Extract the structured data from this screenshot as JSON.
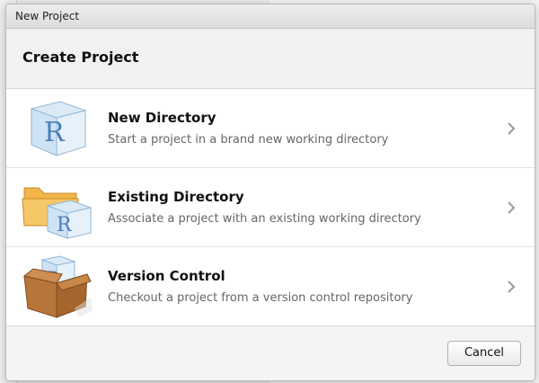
{
  "window": {
    "title": "New Project"
  },
  "header": {
    "title": "Create Project"
  },
  "options": [
    {
      "title": "New Directory",
      "description": "Start a project in a brand new working directory",
      "icon": "r-cube-icon"
    },
    {
      "title": "Existing Directory",
      "description": "Associate a project with an existing working directory",
      "icon": "folder-r-icon"
    },
    {
      "title": "Version Control",
      "description": "Checkout a project from a version control repository",
      "icon": "box-r-icon"
    }
  ],
  "footer": {
    "cancel_label": "Cancel"
  },
  "colors": {
    "accent_blue": "#5b8fc7",
    "folder_orange": "#e8a33c",
    "box_brown": "#b8753a"
  }
}
